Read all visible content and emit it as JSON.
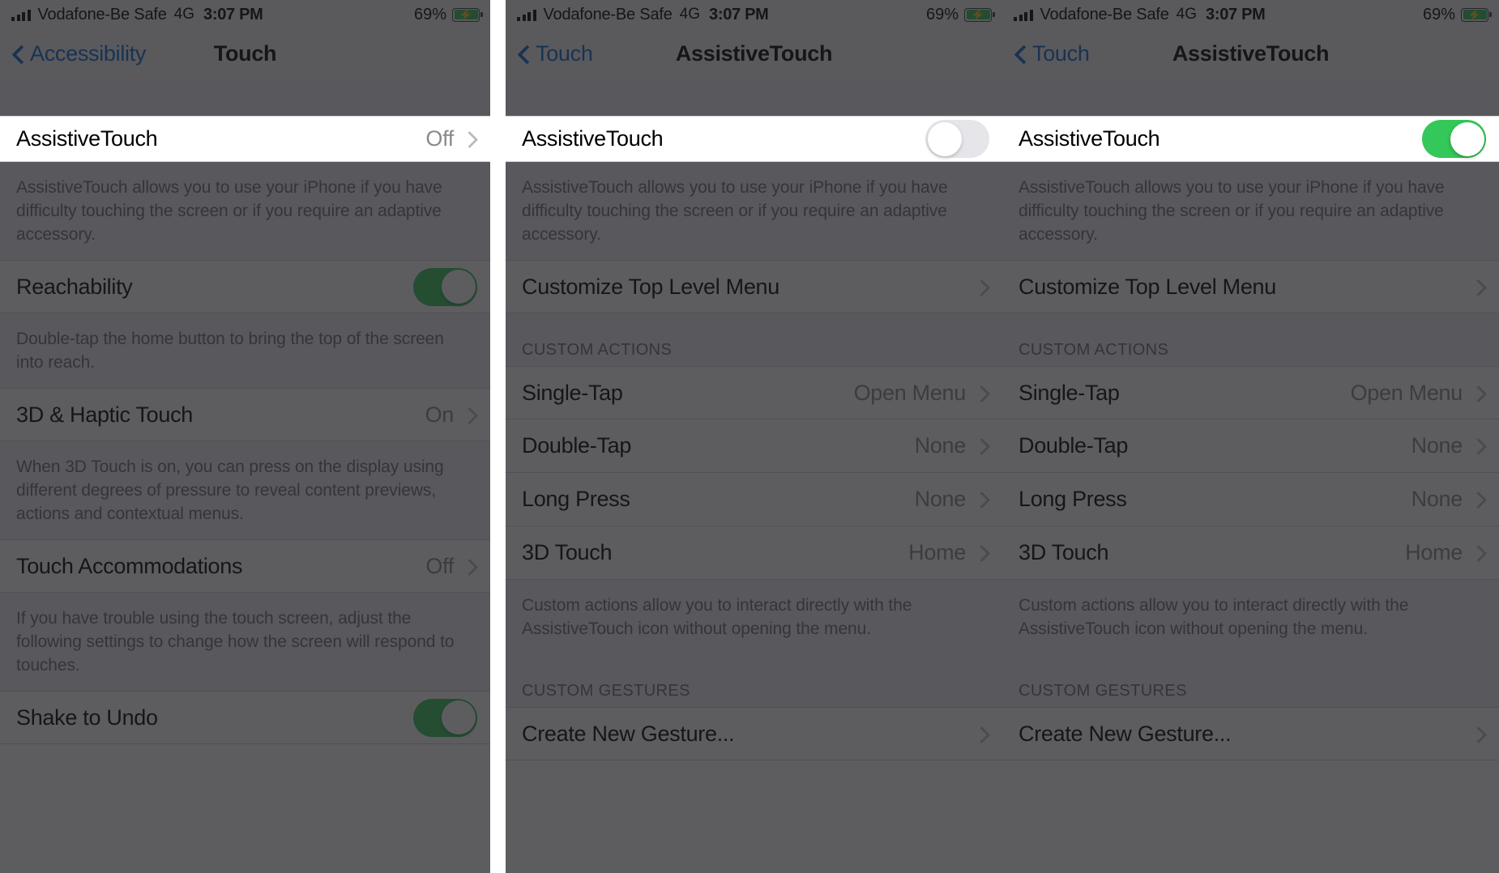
{
  "status_bar": {
    "signal_icon": "cellular-bars-icon",
    "carrier": "Vodafone-Be Safe",
    "network": "4G",
    "time": "3:07 PM",
    "battery_percent": "69%",
    "battery_icon": "battery-charging-icon",
    "battery_color": "#31C65B"
  },
  "colors": {
    "accent_blue": "#0B68C8",
    "toggle_on_green": "#34C759",
    "toggle_off_gray": "#E6E6EA",
    "list_bg": "#EFEFF4",
    "secondary_text": "#8A8A8E",
    "dim_overlay": "rgba(30,30,34,0.72)"
  },
  "panels": [
    {
      "nav": {
        "back_label": "Accessibility",
        "title": "Touch"
      },
      "highlight_row": {
        "label": "AssistiveTouch",
        "value": "Off",
        "control": "disclosure"
      },
      "rows": [
        {
          "type": "footnote",
          "text": "AssistiveTouch allows you to use your iPhone if you have difficulty touching the screen or if you require an adaptive accessory."
        },
        {
          "type": "row",
          "label": "Reachability",
          "control": "toggle",
          "state": "on"
        },
        {
          "type": "footnote",
          "text": "Double-tap the home button to bring the top of the screen into reach."
        },
        {
          "type": "row",
          "label": "3D & Haptic Touch",
          "value": "On",
          "control": "disclosure"
        },
        {
          "type": "footnote",
          "text": "When 3D Touch is on, you can press on the display using different degrees of pressure to reveal content previews, actions and contextual menus."
        },
        {
          "type": "row",
          "label": "Touch Accommodations",
          "value": "Off",
          "control": "disclosure"
        },
        {
          "type": "footnote",
          "text": "If you have trouble using the touch screen, adjust the following settings to change how the screen will respond to touches."
        },
        {
          "type": "row",
          "label": "Shake to Undo",
          "control": "toggle",
          "state": "on"
        }
      ]
    },
    {
      "nav": {
        "back_label": "Touch",
        "title": "AssistiveTouch"
      },
      "highlight_row": {
        "label": "AssistiveTouch",
        "control": "toggle",
        "state": "off"
      },
      "rows": [
        {
          "type": "footnote",
          "text": "AssistiveTouch allows you to use your iPhone if you have difficulty touching the screen or if you require an adaptive accessory."
        },
        {
          "type": "row",
          "label": "Customize Top Level Menu",
          "control": "disclosure"
        },
        {
          "type": "header",
          "text": "CUSTOM ACTIONS"
        },
        {
          "type": "row",
          "label": "Single-Tap",
          "value": "Open Menu",
          "control": "disclosure"
        },
        {
          "type": "row",
          "label": "Double-Tap",
          "value": "None",
          "control": "disclosure"
        },
        {
          "type": "row",
          "label": "Long Press",
          "value": "None",
          "control": "disclosure"
        },
        {
          "type": "row",
          "label": "3D Touch",
          "value": "Home",
          "control": "disclosure"
        },
        {
          "type": "footnote",
          "text": "Custom actions allow you to interact directly with the AssistiveTouch icon without opening the menu."
        },
        {
          "type": "header",
          "text": "CUSTOM GESTURES"
        },
        {
          "type": "row",
          "label": "Create New Gesture...",
          "control": "disclosure"
        }
      ]
    },
    {
      "nav": {
        "back_label": "Touch",
        "title": "AssistiveTouch"
      },
      "highlight_row": {
        "label": "AssistiveTouch",
        "control": "toggle",
        "state": "on"
      },
      "rows": [
        {
          "type": "footnote",
          "text": "AssistiveTouch allows you to use your iPhone if you have difficulty touching the screen or if you require an adaptive accessory."
        },
        {
          "type": "row",
          "label": "Customize Top Level Menu",
          "control": "disclosure"
        },
        {
          "type": "header",
          "text": "CUSTOM ACTIONS"
        },
        {
          "type": "row",
          "label": "Single-Tap",
          "value": "Open Menu",
          "control": "disclosure"
        },
        {
          "type": "row",
          "label": "Double-Tap",
          "value": "None",
          "control": "disclosure"
        },
        {
          "type": "row",
          "label": "Long Press",
          "value": "None",
          "control": "disclosure"
        },
        {
          "type": "row",
          "label": "3D Touch",
          "value": "Home",
          "control": "disclosure"
        },
        {
          "type": "footnote",
          "text": "Custom actions allow you to interact directly with the AssistiveTouch icon without opening the menu."
        },
        {
          "type": "header",
          "text": "CUSTOM GESTURES"
        },
        {
          "type": "row",
          "label": "Create New Gesture...",
          "control": "disclosure"
        }
      ]
    }
  ]
}
